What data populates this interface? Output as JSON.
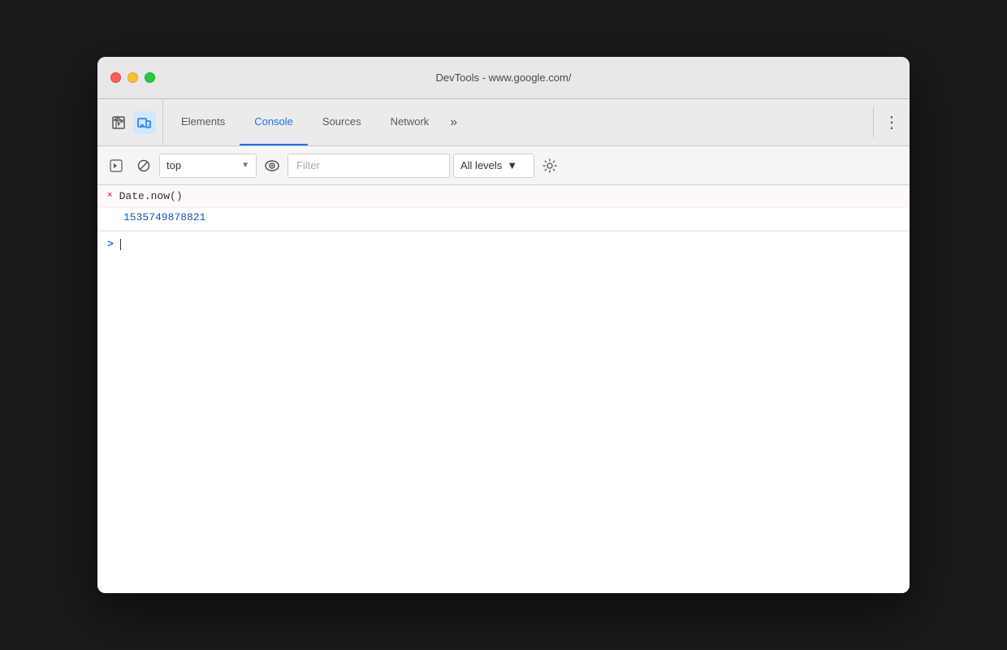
{
  "window": {
    "title": "DevTools - www.google.com/"
  },
  "tabs": {
    "icons": [
      {
        "name": "inspector-icon",
        "label": "Inspector"
      },
      {
        "name": "device-icon",
        "label": "Device"
      }
    ],
    "items": [
      {
        "id": "elements",
        "label": "Elements",
        "active": false
      },
      {
        "id": "console",
        "label": "Console",
        "active": true
      },
      {
        "id": "sources",
        "label": "Sources",
        "active": false
      },
      {
        "id": "network",
        "label": "Network",
        "active": false
      }
    ],
    "overflow_label": "»",
    "menu_label": "⋮"
  },
  "toolbar": {
    "clear_label": "Clear console",
    "block_label": "Block messages",
    "context": {
      "value": "top",
      "placeholder": "top"
    },
    "filter": {
      "placeholder": "Filter"
    },
    "levels": {
      "value": "All levels"
    },
    "settings_label": "Settings"
  },
  "console": {
    "entry": {
      "icon": "×",
      "code": "Date.now()"
    },
    "result": {
      "value": "1535749878821"
    },
    "input": {
      "prompt": ">"
    }
  },
  "colors": {
    "active_tab": "#1a73e8",
    "number": "#1557bf",
    "error_icon": "#c00"
  }
}
